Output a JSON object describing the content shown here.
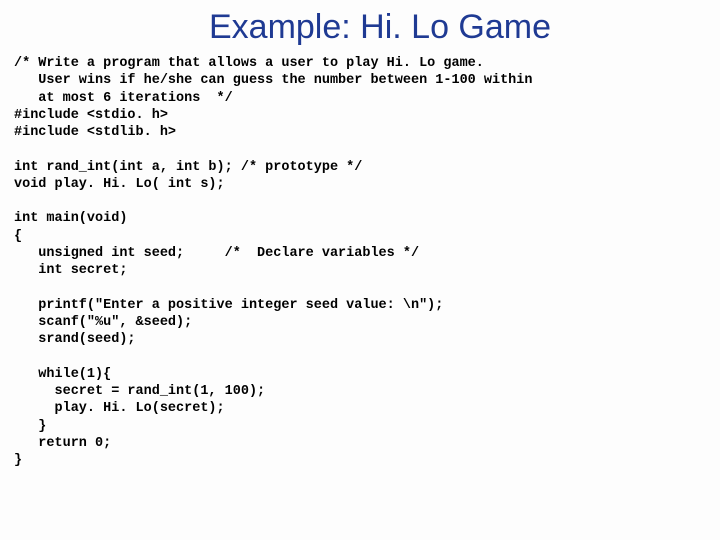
{
  "title": "Example: Hi. Lo Game",
  "code": "/* Write a program that allows a user to play Hi. Lo game.\n   User wins if he/she can guess the number between 1-100 within\n   at most 6 iterations  */\n#include <stdio. h>\n#include <stdlib. h>\n\nint rand_int(int a, int b); /* prototype */\nvoid play. Hi. Lo( int s);\n\nint main(void)\n{\n   unsigned int seed;     /*  Declare variables */\n   int secret;\n\n   printf(\"Enter a positive integer seed value: \\n\");\n   scanf(\"%u\", &seed);\n   srand(seed);\n\n   while(1){\n     secret = rand_int(1, 100);\n     play. Hi. Lo(secret);\n   }\n   return 0;\n}"
}
